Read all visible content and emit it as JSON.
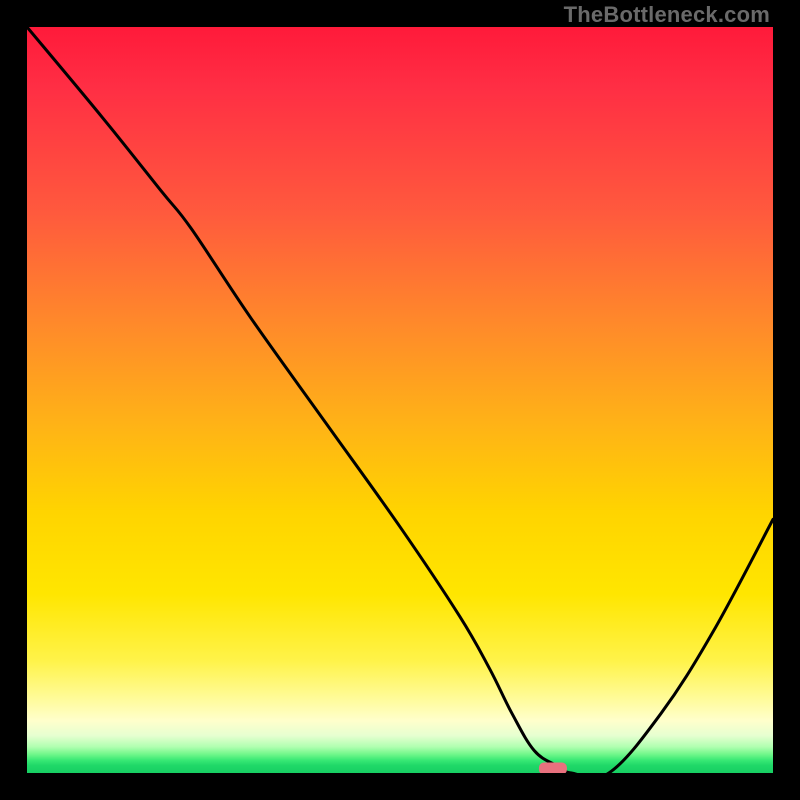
{
  "watermark": "TheBottleneck.com",
  "chart_data": {
    "type": "line",
    "title": "",
    "xlabel": "",
    "ylabel": "",
    "xlim": [
      0,
      100
    ],
    "ylim": [
      0,
      100
    ],
    "grid": false,
    "legend": false,
    "background": "red-yellow-green vertical gradient",
    "series": [
      {
        "name": "bottleneck-curve",
        "x": [
          0,
          10,
          18,
          22,
          30,
          40,
          50,
          58,
          62,
          65,
          68,
          71,
          73,
          78,
          85,
          92,
          100
        ],
        "y": [
          100,
          88,
          78,
          73,
          61,
          47,
          33,
          21,
          14,
          8,
          3,
          1,
          0,
          0,
          8,
          19,
          34
        ]
      }
    ],
    "marker": {
      "name": "optimal-point",
      "x": 70.5,
      "y": 0.6,
      "shape": "rounded-rect",
      "color": "#e8717e"
    }
  }
}
